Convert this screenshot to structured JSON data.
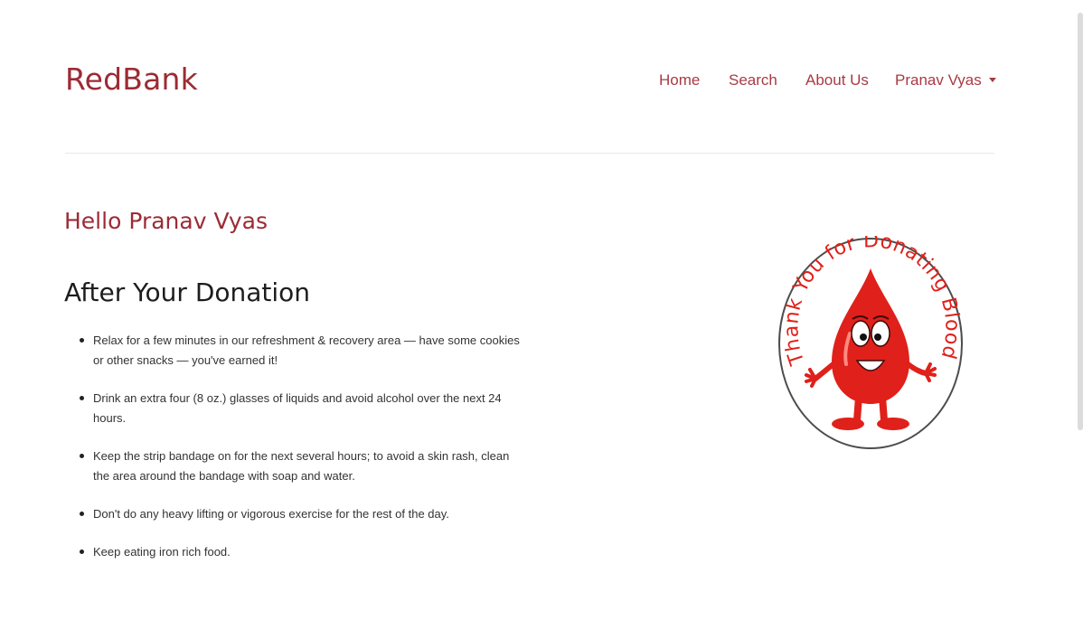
{
  "header": {
    "brand": "RedBank",
    "nav": {
      "home": "Home",
      "search": "Search",
      "about": "About Us",
      "user": "Pranav Vyas"
    }
  },
  "main": {
    "greeting": "Hello Pranav Vyas",
    "title": "After Your Donation",
    "tips": [
      "Relax for a few minutes in our refreshment & recovery area — have some cookies or other snacks — you've earned it!",
      "Drink an extra four (8 oz.) glasses of liquids and avoid alcohol over the next 24 hours.",
      "Keep the strip bandage on for the next several hours; to avoid a skin rash, clean the area around the bandage with soap and water.",
      "Don't do any heavy lifting or vigorous exercise for the rest of the day.",
      "Keep eating iron rich food."
    ],
    "badge": {
      "text": "Thank You for Donating Blood",
      "color": "#e0201a",
      "icon": "blood-drop-mascot-icon"
    }
  },
  "colors": {
    "brand": "#9c2b35",
    "nav": "#a83a44",
    "badge_red": "#e0201a"
  }
}
